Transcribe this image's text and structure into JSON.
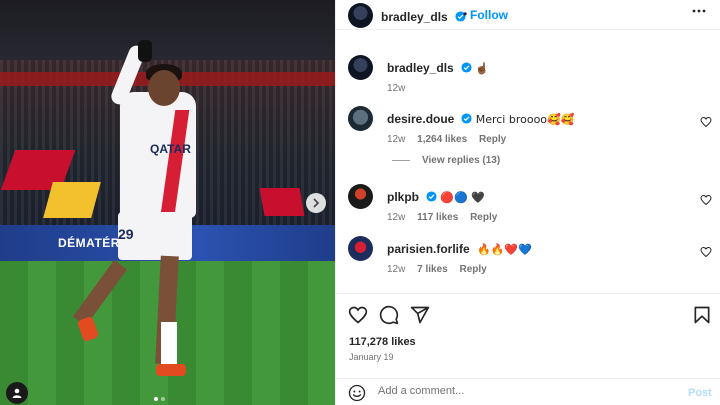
{
  "post": {
    "author": "bradley_dls",
    "follow_label": "Follow",
    "separator": "•",
    "caption_emoji": "☝🏾",
    "caption_time": "12w",
    "ad_board_text": "DÉMATÉR",
    "shirt_sponsor": "QATAR",
    "shirt_number": "29",
    "likes": "117,278 likes",
    "date": "January 19",
    "carousel_dots": 2
  },
  "comments": [
    {
      "user": "desire.doue",
      "verified": true,
      "text": "Merci broooo🥰🥰",
      "time": "12w",
      "likes": "1,264 likes",
      "reply": "Reply"
    },
    {
      "user": "plkpb",
      "verified": true,
      "text": "🔴🔵 🖤",
      "time": "12w",
      "likes": "117 likes",
      "reply": "Reply"
    },
    {
      "user": "parisien.forlife",
      "verified": false,
      "text": "🔥🔥❤️💙",
      "time": "12w",
      "likes": "7 likes",
      "reply": "Reply"
    }
  ],
  "view_replies": "View replies (13)",
  "add_comment": {
    "placeholder": "Add a comment...",
    "post_label": "Post"
  },
  "colors": {
    "accent": "#0095f6",
    "verified": "#0095f6",
    "post_disabled": "#b2dffc"
  },
  "icons": [
    "verified-icon",
    "more-icon",
    "heart-icon",
    "comment-icon",
    "share-icon",
    "bookmark-icon",
    "emoji-icon",
    "next-icon",
    "user-tag-icon"
  ]
}
